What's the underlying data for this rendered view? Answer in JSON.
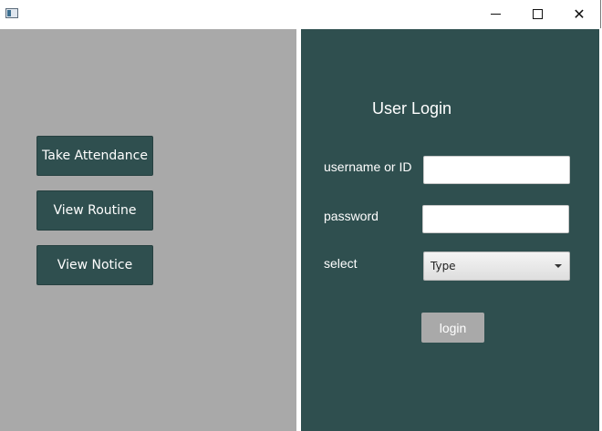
{
  "window": {
    "icon": "app-window-icon",
    "controls": {
      "minimize": "minimize-icon",
      "maximize": "maximize-icon",
      "close": "close-icon",
      "close_glyph": "✕"
    }
  },
  "sidebar": {
    "buttons": [
      {
        "label": "Take Attendance"
      },
      {
        "label": "View Routine"
      },
      {
        "label": "View Notice"
      }
    ]
  },
  "login": {
    "title": "User Login",
    "username_label": "username or ID",
    "username_value": "",
    "password_label": "password",
    "password_value": "",
    "select_label": "select",
    "select_value": "Type",
    "submit_label": "login"
  },
  "colors": {
    "panel_left": "#a9a9a9",
    "panel_right": "#2f4f4f",
    "button_dark": "#2f4f4f",
    "button_login": "#a9a9a9"
  }
}
